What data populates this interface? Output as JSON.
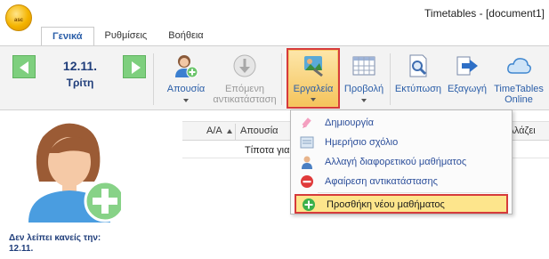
{
  "app": {
    "title": "Timetables - [document1]",
    "logo_text": "asc"
  },
  "tabs": [
    {
      "label": "Γενικά",
      "active": true
    },
    {
      "label": "Ρυθμίσεις",
      "active": false
    },
    {
      "label": "Βοήθεια",
      "active": false
    }
  ],
  "ribbon": {
    "date": "12.11.",
    "day": "Τρίτη",
    "absence_label": "Απουσία",
    "next_sub_line1": "Επόμενη",
    "next_sub_line2": "αντικατάσταση",
    "tools_label": "Εργαλεία",
    "view_label": "Προβολή",
    "print_label": "Εκτύπωση",
    "export_label": "Εξαγωγή",
    "online_line1": "TimeTables",
    "online_line2": "Online"
  },
  "left_panel": {
    "caption_line1": "Δεν λείπει κανείς την:",
    "caption_line2": "12.11."
  },
  "table": {
    "col_aa": "A/A",
    "col_absence": "Απουσία",
    "col_changes": "Αλλάζει",
    "empty_text": "Τίποτα για"
  },
  "tools_menu": [
    {
      "label": "Δημιουργία",
      "icon": "create-icon"
    },
    {
      "label": "Ημερήσιο σχόλιο",
      "icon": "comment-icon"
    },
    {
      "label": "Αλλαγή διαφορετικού μαθήματος",
      "icon": "teacher-icon"
    },
    {
      "label": "Αφαίρεση αντικατάστασης",
      "icon": "remove-icon"
    },
    {
      "label": "Προσθήκη νέου μαθήματος",
      "icon": "add-icon",
      "highlighted": true
    }
  ],
  "colors": {
    "accent": "#2b5ea8",
    "highlight": "#fde58c",
    "annotation": "#d63b3b",
    "nav_green": "#7ecf7e"
  }
}
